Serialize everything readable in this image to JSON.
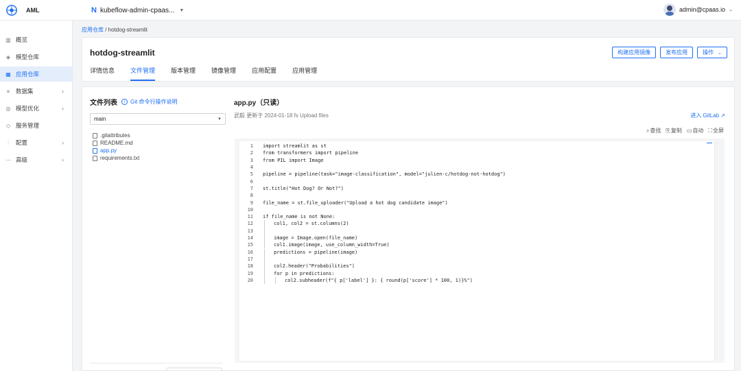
{
  "app": {
    "name": "AML"
  },
  "project": {
    "name": "kubeflow-admin-cpaas..."
  },
  "user": {
    "name": "admin@cpaas.io"
  },
  "sidebar": {
    "items": [
      {
        "label": "概览",
        "icon": "chart-icon",
        "has_children": false,
        "active": false
      },
      {
        "label": "模型仓库",
        "icon": "cube-icon",
        "has_children": false,
        "active": false
      },
      {
        "label": "应用仓库",
        "icon": "grid-icon",
        "has_children": false,
        "active": true
      },
      {
        "label": "数据集",
        "icon": "database-icon",
        "has_children": true,
        "active": false
      },
      {
        "label": "模型优化",
        "icon": "target-icon",
        "has_children": true,
        "active": false
      },
      {
        "label": "服务管理",
        "icon": "service-icon",
        "has_children": false,
        "active": false
      },
      {
        "label": "配置",
        "icon": "sliders-icon",
        "has_children": true,
        "active": false
      },
      {
        "label": "高级",
        "icon": "dots-icon",
        "has_children": true,
        "active": false
      }
    ]
  },
  "breadcrumb": {
    "parent": "应用仓库",
    "separator": " / ",
    "current": "hotdog-streamlit"
  },
  "header": {
    "title": "hotdog-streamlit",
    "buttons": {
      "build_image": "构建应用镜像",
      "publish": "发布应用",
      "actions": "操作"
    },
    "tabs": [
      "详情信息",
      "文件管理",
      "版本管理",
      "镜像管理",
      "应用配置",
      "应用管理"
    ],
    "active_tab": 1
  },
  "files": {
    "title": "文件列表",
    "git_help": "Git 命令行操作说明",
    "branch": "main",
    "items": [
      ".gitattributes",
      "README.md",
      "app.py",
      "requirements.txt"
    ],
    "active_item": 2
  },
  "code": {
    "title": "app.py（只读）",
    "meta": "武毅 更新于 2024-01-18 fs Upload files",
    "gitlab_link": "进入 GitLab",
    "tools": {
      "find": "查找",
      "copy": "复制",
      "wrap": "自动",
      "fullscreen": "全屏"
    },
    "lines": [
      {
        "n": "1",
        "text": "import streamlit as st",
        "indent": 0
      },
      {
        "n": "2",
        "text": "from transformers import pipeline",
        "indent": 0
      },
      {
        "n": "3",
        "text": "from PIL import Image",
        "indent": 0
      },
      {
        "n": "4",
        "text": "",
        "indent": 0
      },
      {
        "n": "5",
        "text": "pipeline = pipeline(task=\"image-classification\", model=\"julien-c/hotdog-not-hotdog\")",
        "indent": 0
      },
      {
        "n": "6",
        "text": "",
        "indent": 0
      },
      {
        "n": "7",
        "text": "st.title(\"Hot Dog? Or Not?\")",
        "indent": 0
      },
      {
        "n": "8",
        "text": "",
        "indent": 0
      },
      {
        "n": "9",
        "text": "file_name = st.file_uploader(\"Upload a hot dog candidate image\")",
        "indent": 0
      },
      {
        "n": "10",
        "text": "",
        "indent": 0
      },
      {
        "n": "11",
        "text": "if file_name is not None:",
        "indent": 0
      },
      {
        "n": "12",
        "text": "col1, col2 = st.columns(2)",
        "indent": 1
      },
      {
        "n": "13",
        "text": "",
        "indent": 1
      },
      {
        "n": "14",
        "text": "image = Image.open(file_name)",
        "indent": 1
      },
      {
        "n": "15",
        "text": "col1.image(image, use_column_width=True)",
        "indent": 1
      },
      {
        "n": "16",
        "text": "predictions = pipeline(image)",
        "indent": 1
      },
      {
        "n": "17",
        "text": "",
        "indent": 1
      },
      {
        "n": "18",
        "text": "col2.header(\"Probabilities\")",
        "indent": 1
      },
      {
        "n": "19",
        "text": "for p in predictions:",
        "indent": 1
      },
      {
        "n": "20",
        "text": "col2.subheader(f\"{ p['label'] }: { round(p['score'] * 100, 1)}%\")",
        "indent": 2
      }
    ]
  },
  "colors": {
    "accent": "#1e6ff3",
    "active_bg": "#e3edfc",
    "page_bg": "#f3f4f6"
  }
}
